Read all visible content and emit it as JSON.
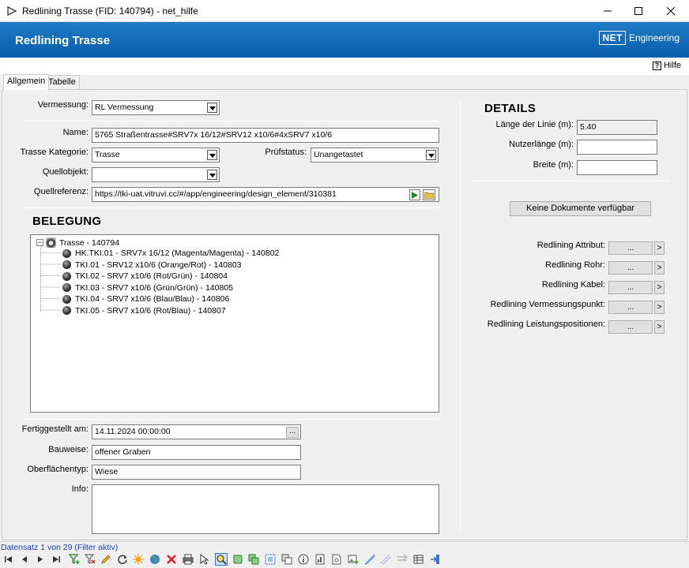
{
  "window": {
    "title": "Redlining Trasse (FID: 140794) - net_hilfe"
  },
  "banner": {
    "title": "Redlining Trasse",
    "logo_box": "NET",
    "logo_text": "Engineering"
  },
  "help": {
    "icon": "?",
    "label": "Hilfe"
  },
  "tabs": [
    {
      "label": "Allgemein"
    },
    {
      "label": "Tabelle"
    }
  ],
  "form": {
    "vermessung_label": "Vermessung:",
    "vermessung_value": "RL Vermessung",
    "name_label": "Name:",
    "name_value": "5765 Straßentrasse#SRV7x 16/12#SRV12 x10/6#4xSRV7 x10/6",
    "kategorie_label": "Trasse Kategorie:",
    "kategorie_value": "Trasse",
    "pruefstatus_label": "Prüfstatus:",
    "pruefstatus_value": "Unangetastet",
    "quellobjekt_label": "Quellobjekt:",
    "quellobjekt_value": "",
    "quellreferenz_label": "Quellreferenz:",
    "quellreferenz_value": "https://tki-uat.vitruvi.cc/#/app/engineering/design_element/310381"
  },
  "belegung": {
    "title": "BELEGUNG",
    "root": "Trasse - 140794",
    "children": [
      "HK.TKI.01 - SRV7x 16/12 (Magenta/Magenta) - 140802",
      "TKI.01 - SRV12 x10/6 (Orange/Rot) - 140803",
      "TKI.02 - SRV7 x10/6 (Rot/Grün) - 140804",
      "TKI.03 - SRV7 x10/6 (Grün/Grün) - 140805",
      "TKI.04 - SRV7 x10/6 (Blau/Blau) - 140806",
      "TKI.05 - SRV7 x10/6 (Rot/Blau) - 140807"
    ]
  },
  "bottom": {
    "fertig_label": "Fertiggestellt am:",
    "fertig_value": "14.11.2024 00:00:00",
    "fertig_btn": "...",
    "bauweise_label": "Bauweise:",
    "bauweise_value": "offener Graben",
    "oberflaeche_label": "Oberflächentyp:",
    "oberflaeche_value": "Wiese",
    "info_label": "Info:",
    "info_value": ""
  },
  "details": {
    "title": "DETAILS",
    "laenge_label": "Länge der Linie (m):",
    "laenge_value": "5.40",
    "nutzer_label": "Nutzerlänge (m):",
    "nutzer_value": "",
    "breite_label": "Breite (m):",
    "breite_value": "",
    "docs_button": "Keine Dokumente verfügbar",
    "redlining": [
      {
        "label": "Redlining Attribut:",
        "btn": "...",
        "go": ">"
      },
      {
        "label": "Redlining Rohr:",
        "btn": "...",
        "go": ">"
      },
      {
        "label": "Redlining Kabel:",
        "btn": "...",
        "go": ">"
      },
      {
        "label": "Redlining Vermessungspunkt:",
        "btn": "...",
        "go": ">"
      },
      {
        "label": "Redlining Leistungspositionen:",
        "btn": "...",
        "go": ">"
      }
    ]
  },
  "status": {
    "record": "Datensatz 1 von 29 (Filter aktiv)"
  },
  "colors": {
    "banner": "#0a5da8",
    "status_text": "#1a3cc8"
  }
}
